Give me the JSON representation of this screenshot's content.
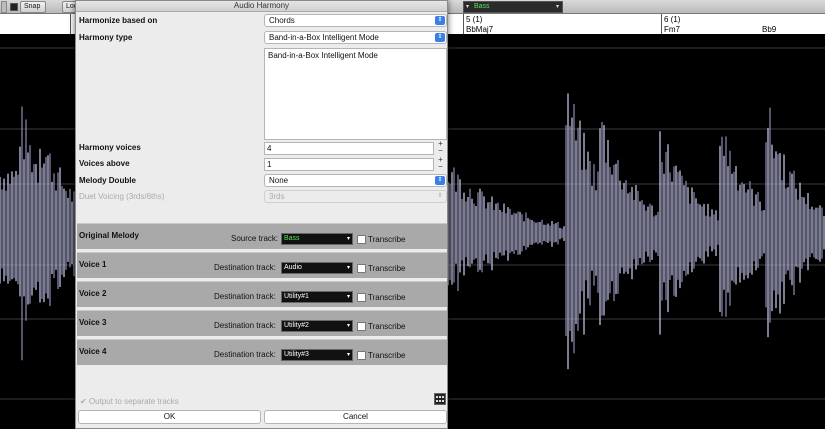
{
  "toolbar": {
    "snap_label": "Snap",
    "lock_label": "Loc",
    "track_select": "Bass"
  },
  "ruler": {
    "marks": [
      {
        "bar": "5 (1)",
        "chord": "BbMaj7"
      },
      {
        "bar": "6 (1)",
        "chord": "Fm7"
      }
    ],
    "extra_chord": "Bb9"
  },
  "dialog": {
    "title": "Audio Harmony",
    "harmonize_label": "Harmonize based on",
    "harmonize_value": "Chords",
    "harmony_type_label": "Harmony type",
    "harmony_type_value": "Band-in-a-Box Intelligent Mode",
    "mode_description": "Band-in-a-Box Intelligent Mode",
    "harmony_voices_label": "Harmony voices",
    "harmony_voices_value": "4",
    "voices_above_label": "Voices above",
    "voices_above_value": "1",
    "melody_double_label": "Melody Double",
    "melody_double_value": "None",
    "duet_label": "Duet Voicing (3rds/6ths)",
    "duet_value": "3rds",
    "rows": [
      {
        "name": "Original Melody",
        "track_label": "Source track:",
        "track": "Bass",
        "transcribe": "Transcribe"
      },
      {
        "name": "Voice 1",
        "track_label": "Destination track:",
        "track": "Audio",
        "transcribe": "Transcribe"
      },
      {
        "name": "Voice 2",
        "track_label": "Destination track:",
        "track": "Utility#1",
        "transcribe": "Transcribe"
      },
      {
        "name": "Voice 3",
        "track_label": "Destination track:",
        "track": "Utility#2",
        "transcribe": "Transcribe"
      },
      {
        "name": "Voice 4",
        "track_label": "Destination track:",
        "track": "Utility#3",
        "transcribe": "Transcribe"
      }
    ],
    "output_separate_label": "Output to separate tracks",
    "ok_label": "OK",
    "cancel_label": "Cancel"
  },
  "colors": {
    "waveform": "#cfcff0",
    "accent": "#3b7fe6",
    "source_track_text": "#5fe05f"
  }
}
